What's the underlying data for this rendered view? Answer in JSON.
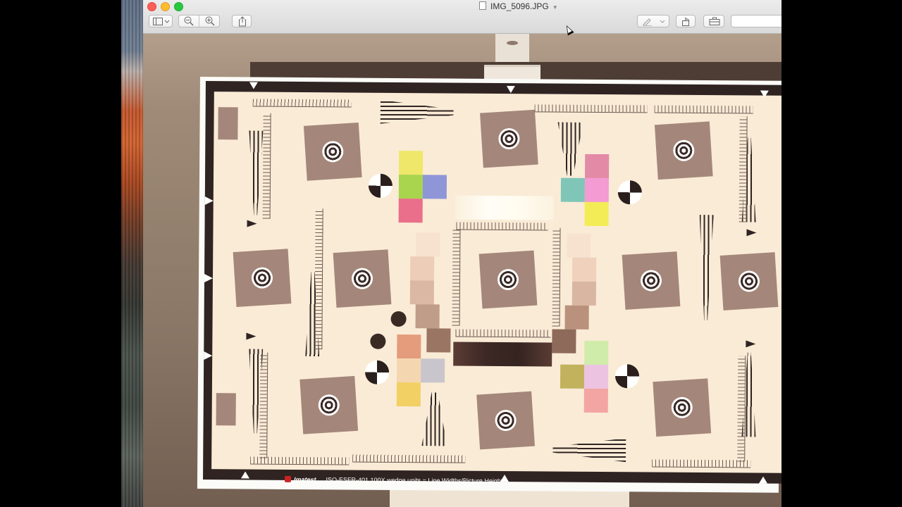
{
  "window": {
    "title": "IMG_5096.JPG"
  },
  "toolbar": {
    "sidebar_icon": "sidebar-icon",
    "zoom_out_icon": "zoom-out-icon",
    "zoom_in_icon": "zoom-in-icon",
    "share_icon": "share-icon",
    "markup_icon": "pen-icon",
    "rotate_icon": "rotate-icon",
    "toolbox_icon": "toolbox-icon"
  },
  "chart": {
    "brand": "Imatest",
    "caption": "ISO-ESFR-401 100X wedge units = Line Widths/Picture Height"
  },
  "colors": {
    "accent_close": "#fc5f57",
    "accent_min": "#fdbc2e",
    "accent_zoom": "#28c840",
    "chart_face": "#faebd6",
    "slanted_square": "#a4877a"
  }
}
